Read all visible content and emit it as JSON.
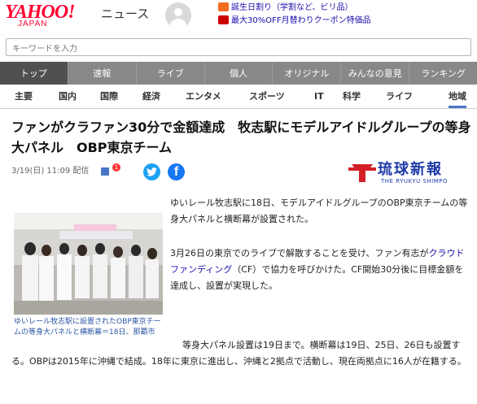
{
  "header": {
    "logo_text": "YAHOO!",
    "logo_sub": "JAPAN",
    "service": "ニュース",
    "promos": [
      {
        "text": "誕生日割り（学割など、ビリ品）",
        "color": "#f26d21"
      },
      {
        "text": "最大30%OFF月替わりクーポン特価品",
        "color": "#c00"
      }
    ]
  },
  "search": {
    "placeholder": "キーワードを入力"
  },
  "global_nav": [
    "トップ",
    "速報",
    "ライブ",
    "個人",
    "オリジナル",
    "みんなの意見",
    "ランキング"
  ],
  "category_nav": [
    "主要",
    "国内",
    "国際",
    "経済",
    "エンタメ",
    "スポーツ",
    "IT",
    "科学",
    "ライフ",
    "地域"
  ],
  "article": {
    "title": "ファンがクラファン30分で金額達成　牧志駅にモデルアイドルグループの等身大パネル　OBP東京チーム",
    "datetime": "3/19(日) 11:09 配信",
    "comment_count": "1",
    "publisher_jp": "琉球新報",
    "publisher_en": "THE RYUKYU SHIMPO",
    "caption": "ゆいレール牧志駅に設置されたOBP東京チームの等身大パネルと横断幕＝18日、那覇市",
    "para1": "ゆいレール牧志駅に18日、モデルアイドルグループのOBP東京チームの等身大パネルと横断幕が設置された。",
    "para2_a": "3月26日の東京でのライブで解散することを受け、ファン有志が",
    "para2_link": "クラウドファンディング",
    "para2_b": "（CF）で協力を呼びかけた。CF開始30分後に目標金額を達成し、設置が実現した。",
    "para3": "等身大パネル設置は19日まで。横断幕は19日、25日、26日も設置する。OBPは2015年に沖縄で結成。18年に東京に進出し、沖縄と2拠点で活動し、現在両拠点に16人が在籍する。"
  }
}
